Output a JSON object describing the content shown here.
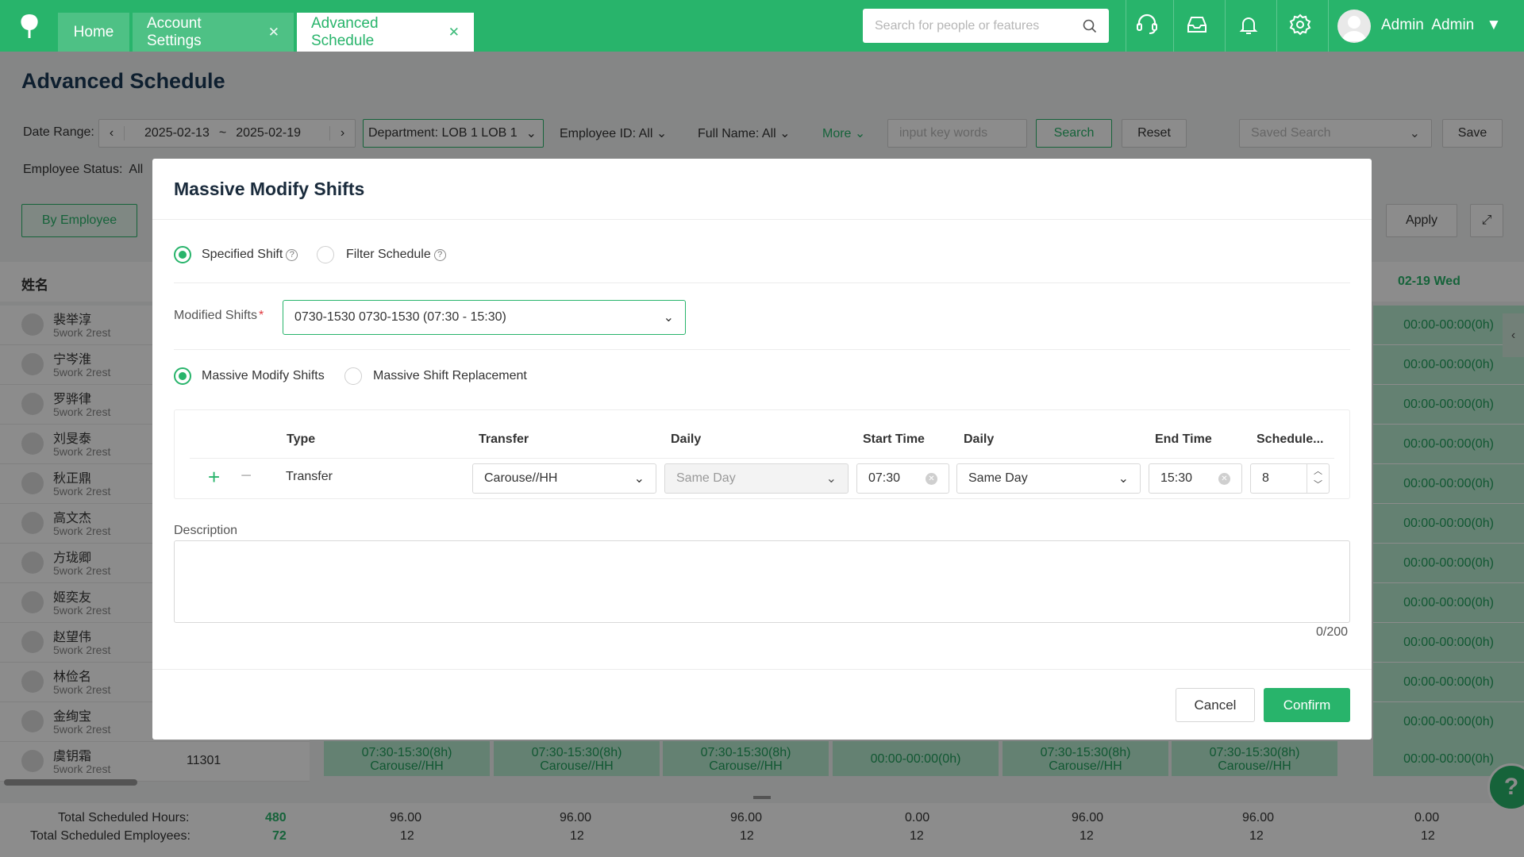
{
  "topbar": {
    "tabs": [
      {
        "label": "Home"
      },
      {
        "label": "Account Settings"
      },
      {
        "label": "Advanced Schedule"
      }
    ],
    "search_placeholder": "Search for people or features",
    "user": {
      "first": "Admin",
      "last": "Admin"
    }
  },
  "page": {
    "title": "Advanced Schedule",
    "filters": {
      "date_range_label": "Date Range:",
      "date_start": "2025-02-13",
      "date_sep": "~",
      "date_end": "2025-02-19",
      "department_label": "Department:",
      "department_value": "LOB 1 LOB 1",
      "employee_id_label": "Employee ID:",
      "employee_id_value": "All",
      "full_name_label": "Full Name:",
      "full_name_value": "All",
      "more_label": "More",
      "keywords_placeholder": "input key words",
      "search_button": "Search",
      "reset_button": "Reset",
      "saved_search_placeholder": "Saved Search",
      "save_button": "Save",
      "employee_status_label": "Employee Status:",
      "employee_status_value": "All"
    },
    "view_button": "By Employee",
    "apply_button": "Apply",
    "name_column": "姓名",
    "day_header_last": "02-19 Wed",
    "employees": [
      {
        "name": "裴举淳",
        "sub": "5work 2rest"
      },
      {
        "name": "宁岑淮",
        "sub": "5work 2rest"
      },
      {
        "name": "罗骅律",
        "sub": "5work 2rest"
      },
      {
        "name": "刘旻泰",
        "sub": "5work 2rest"
      },
      {
        "name": "秋正鼎",
        "sub": "5work 2rest"
      },
      {
        "name": "高文杰",
        "sub": "5work 2rest"
      },
      {
        "name": "方珑卿",
        "sub": "5work 2rest"
      },
      {
        "name": "姬奕友",
        "sub": "5work 2rest"
      },
      {
        "name": "赵望伟",
        "sub": "5work 2rest"
      },
      {
        "name": "林俭名",
        "sub": "5work 2rest"
      },
      {
        "name": "金绚宝",
        "sub": "5work 2rest"
      },
      {
        "name": "虞钥霜",
        "sub": "5work 2rest",
        "id": "11301"
      }
    ],
    "right_cell_text": "00:00-00:00(0h)",
    "last_row_cells": [
      {
        "line1": "07:30-15:30(8h)",
        "line2": "Carouse//HH"
      },
      {
        "line1": "07:30-15:30(8h)",
        "line2": "Carouse//HH"
      },
      {
        "line1": "07:30-15:30(8h)",
        "line2": "Carouse//HH"
      },
      {
        "line1": "00:00-00:00(0h)",
        "line2": ""
      },
      {
        "line1": "07:30-15:30(8h)",
        "line2": "Carouse//HH"
      },
      {
        "line1": "07:30-15:30(8h)",
        "line2": "Carouse//HH"
      },
      {
        "line1": "00:00-00:00(0h)",
        "line2": ""
      }
    ],
    "totals": {
      "hours_label": "Total Scheduled Hours:",
      "employees_label": "Total Scheduled Employees:",
      "hours_total": "480",
      "employees_total": "72",
      "hours": [
        "96.00",
        "96.00",
        "96.00",
        "0.00",
        "96.00",
        "96.00",
        "0.00"
      ],
      "employees": [
        "12",
        "12",
        "12",
        "12",
        "12",
        "12",
        "12"
      ]
    }
  },
  "modal": {
    "title": "Massive Modify Shifts",
    "option_specified": "Specified Shift",
    "option_filter": "Filter Schedule",
    "modified_shifts_label": "Modified Shifts",
    "required_mark": "*",
    "modified_shifts_value": "0730-1530 0730-1530 (07:30 - 15:30)",
    "mode_massive": "Massive Modify Shifts",
    "mode_replacement": "Massive Shift Replacement",
    "table": {
      "headers": [
        "Type",
        "Transfer",
        "Daily",
        "Start Time",
        "Daily",
        "End Time",
        "Schedule..."
      ],
      "row": {
        "type": "Transfer",
        "transfer": "Carouse//HH",
        "start_daily": "Same Day",
        "start_time": "07:30",
        "end_daily": "Same Day",
        "end_time": "15:30",
        "schedule_hours": "8"
      }
    },
    "description_label": "Description",
    "char_count": "0/200",
    "cancel": "Cancel",
    "confirm": "Confirm"
  }
}
